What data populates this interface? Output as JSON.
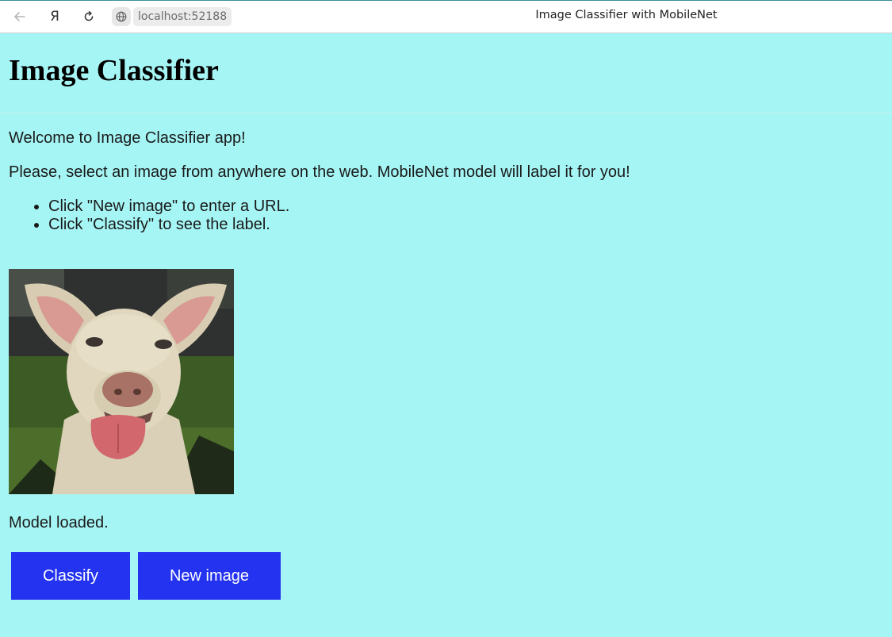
{
  "browser": {
    "url": "localhost:52188",
    "tab_title": "Image Classifier with MobileNet",
    "ya_glyph": "Я"
  },
  "page": {
    "heading": "Image Classifier",
    "welcome": "Welcome to Image Classifier app!",
    "instructions": "Please, select an image from anywhere on the web. MobileNet model will label it for you!",
    "steps": [
      "Click \"New image\" to enter a URL.",
      "Click \"Classify\" to see the label."
    ],
    "image_icon": "dog-photo",
    "status": "Model loaded.",
    "buttons": {
      "classify": "Classify",
      "new_image": "New image"
    }
  },
  "colors": {
    "background": "#a6f5f5",
    "button": "#2433ef",
    "button_text": "#ffffff"
  }
}
